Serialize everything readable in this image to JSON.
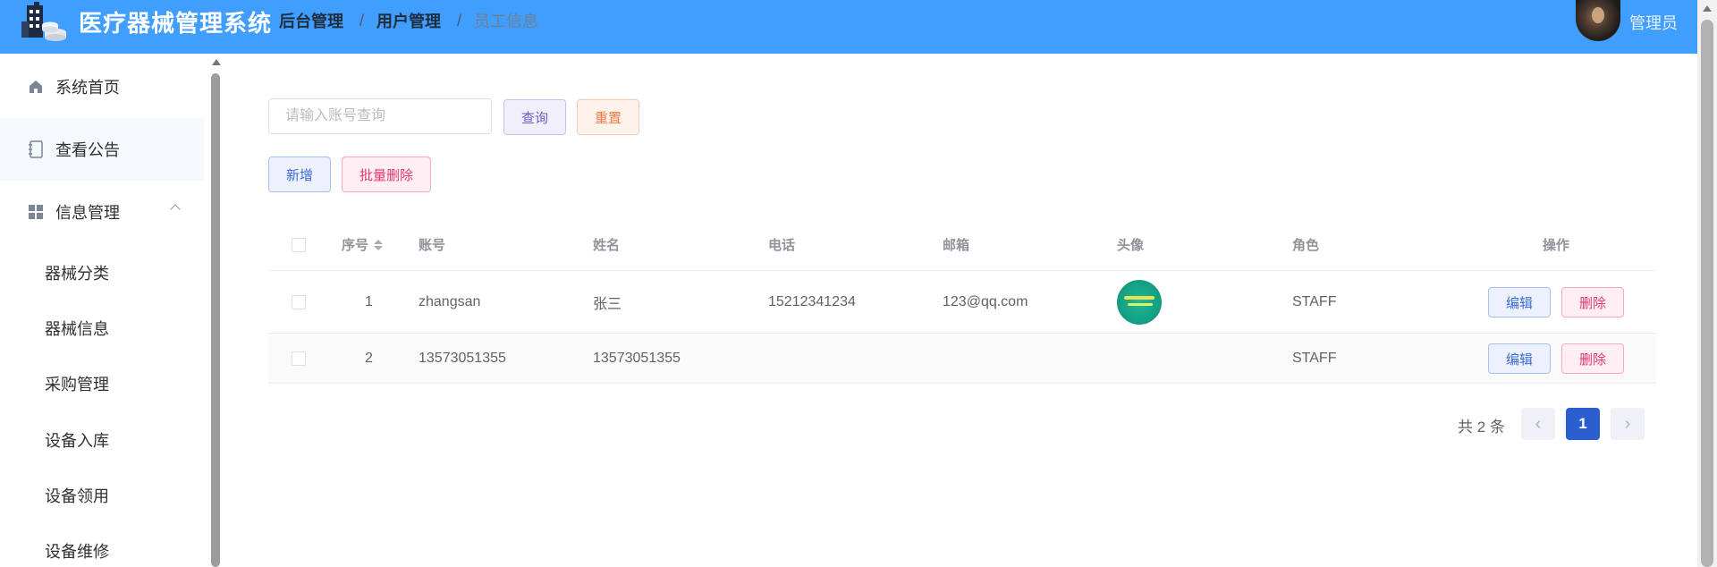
{
  "header": {
    "app_title": "医疗器械管理系统",
    "breadcrumbs": [
      "后台管理",
      "用户管理",
      "员工信息"
    ],
    "breadcrumb_separator": "/",
    "user_name": "管理员",
    "bg_color": "#409eff"
  },
  "sidebar": {
    "items": [
      {
        "label": "系统首页",
        "icon": "home-icon"
      },
      {
        "label": "查看公告",
        "icon": "notebook-icon"
      },
      {
        "label": "信息管理",
        "icon": "grid-icon"
      }
    ],
    "sub_items": [
      "器械分类",
      "器械信息",
      "采购管理",
      "设备入库",
      "设备领用",
      "设备维修"
    ]
  },
  "search": {
    "placeholder": "请输入账号查询",
    "query_label": "查询",
    "reset_label": "重置"
  },
  "toolbar": {
    "add_label": "新增",
    "batch_delete_label": "批量删除"
  },
  "table": {
    "columns": [
      "序号",
      "账号",
      "姓名",
      "电话",
      "邮箱",
      "头像",
      "角色",
      "操作"
    ],
    "rows": [
      {
        "index": "1",
        "username": "zhangsan",
        "name": "张三",
        "phone": "15212341234",
        "email": "123@qq.com",
        "role": "STAFF",
        "has_avatar": true
      },
      {
        "index": "2",
        "username": "13573051355",
        "name": "13573051355",
        "phone": "",
        "email": "",
        "role": "STAFF",
        "has_avatar": false
      }
    ],
    "edit_label": "编辑",
    "delete_label": "删除"
  },
  "pagination": {
    "total_text": "共 2 条",
    "current_page": "1"
  }
}
